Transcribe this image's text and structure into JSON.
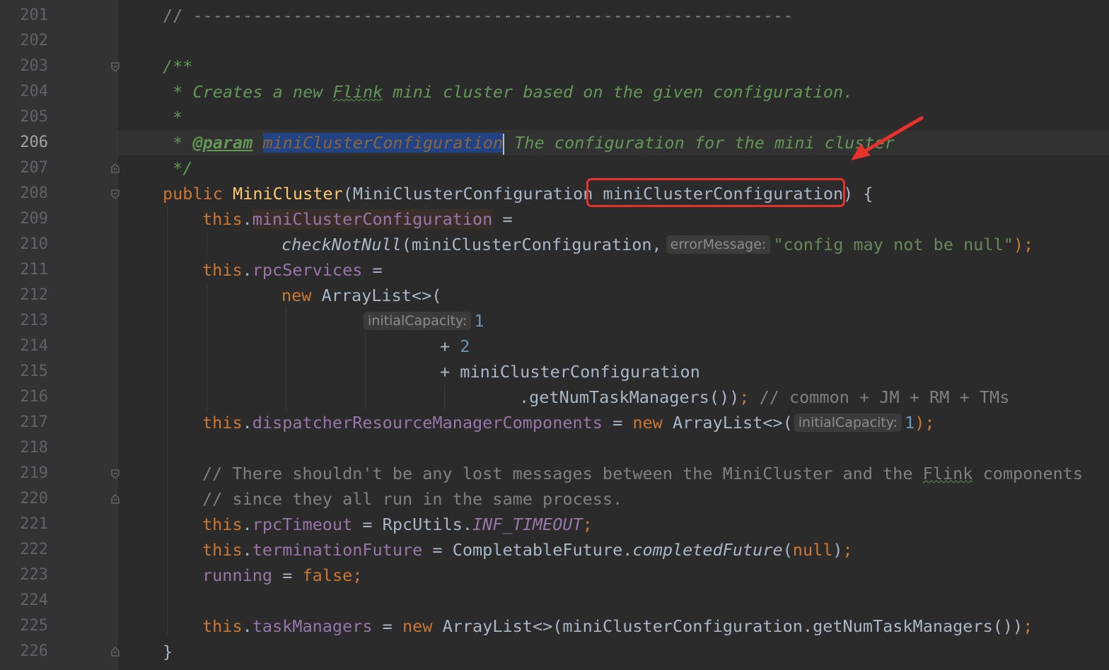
{
  "editor": {
    "current_line": 206,
    "lines": [
      {
        "n": "201",
        "t": "// ------------------------------------------------------------"
      },
      {
        "n": "202",
        "t": ""
      },
      {
        "n": "203",
        "t": "/**"
      },
      {
        "n": "204",
        "t": " * Creates a new Flink mini cluster based on the given configuration."
      },
      {
        "n": "205",
        "t": " *"
      },
      {
        "n": "206",
        "t": " * @param miniClusterConfiguration The configuration for the mini cluster"
      },
      {
        "n": "207",
        "t": " */"
      },
      {
        "n": "208",
        "t": "public MiniCluster(MiniClusterConfiguration miniClusterConfiguration) {"
      },
      {
        "n": "209",
        "t": "this.miniClusterConfiguration ="
      },
      {
        "n": "210",
        "t": "checkNotNull(miniClusterConfiguration, errorMessage: \"config may not be null\");"
      },
      {
        "n": "211",
        "t": "this.rpcServices ="
      },
      {
        "n": "212",
        "t": "new ArrayList<>("
      },
      {
        "n": "213",
        "t": "initialCapacity: 1"
      },
      {
        "n": "214",
        "t": "+ 2"
      },
      {
        "n": "215",
        "t": "+ miniClusterConfiguration"
      },
      {
        "n": "216",
        "t": ".getNumTaskManagers()); // common + JM + RM + TMs"
      },
      {
        "n": "217",
        "t": "this.dispatcherResourceManagerComponents = new ArrayList<>( initialCapacity: 1);"
      },
      {
        "n": "218",
        "t": ""
      },
      {
        "n": "219",
        "t": "// There shouldn't be any lost messages between the MiniCluster and the Flink components"
      },
      {
        "n": "220",
        "t": "// since they all run in the same process."
      },
      {
        "n": "221",
        "t": "this.rpcTimeout = RpcUtils.INF_TIMEOUT;"
      },
      {
        "n": "222",
        "t": "this.terminationFuture = CompletableFuture.completedFuture(null);"
      },
      {
        "n": "223",
        "t": "running = false;"
      },
      {
        "n": "224",
        "t": ""
      },
      {
        "n": "225",
        "t": "this.taskManagers = new ArrayList<>(miniClusterConfiguration.getNumTaskManagers());"
      },
      {
        "n": "226",
        "t": "}"
      }
    ]
  },
  "tokens": {
    "l201": "// ------------------------------------------------------------",
    "l203": "/**",
    "l204_a": " * Creates a new ",
    "l204_b": "Flink",
    "l204_c": " mini cluster based on the given configuration.",
    "l205": " *",
    "l206_a": " * ",
    "l206_tag": "@param",
    "l206_sp": " ",
    "l206_param": "miniClusterConfiguration",
    "l206_rest": " The configuration for the mini cluster",
    "l207": " */",
    "l208_kw": "public",
    "l208_fn": "MiniCluster",
    "l208_a": "(MiniClusterConfiguration",
    "l208_b": " miniClusterConfiguration)",
    "l208_c": " {",
    "this": "this",
    "dot": ".",
    "l209_f": "miniClusterConfiguration",
    "l209_eq": " =",
    "l210_fn": "checkNotNull",
    "l210_a": "(miniClusterConfiguration,",
    "l210_hint": "errorMessage:",
    "l210_str": "\"config may not be null\"",
    "l210_end": ");",
    "l211_f": "rpcServices",
    "l211_eq": " =",
    "new": "new",
    "l212_b": " ArrayList<>(",
    "l213_hint": "initialCapacity:",
    "l213_n": "1",
    "l214_a": "+ ",
    "l214_n": "2",
    "l215": "+ miniClusterConfiguration",
    "l216_a": ".getNumTaskManagers())",
    "l216_semi": ";",
    "l216_cm": " // common + JM + RM + TMs",
    "l217_f": "dispatcherResourceManagerComponents",
    "l217_eq": " = ",
    "l217_b": " ArrayList<>(",
    "l217_hint": "initialCapacity:",
    "l217_n": "1",
    "l217_end": ");",
    "l219_a": "// There shouldn't be any lost messages between the MiniCluster and the ",
    "l219_b": "Flink",
    "l219_c": " components",
    "l220": "// since they all run in the same process.",
    "l221_f": "rpcTimeout",
    "l221_a": " = RpcUtils.",
    "l221_st": "INF_TIMEOUT",
    "semi": ";",
    "l222_f": "terminationFuture",
    "l222_a": " = CompletableFuture.",
    "l222_fn": "completedFuture",
    "l222_b": "(",
    "null": "null",
    "l222_c": ")",
    "l223_f": "running",
    "l223_a": " = ",
    "false": "false",
    "l225_f": "taskManagers",
    "l225_a": " = ",
    "l225_b": " ArrayList<>(miniClusterConfiguration.getNumTaskManagers())",
    "l226": "}"
  },
  "colors": {
    "background": "#2b2b2b",
    "keyword": "#cc7832",
    "comment": "#808080",
    "doc_comment": "#629755",
    "method_decl": "#ffc66d",
    "field": "#9876aa",
    "number": "#6897bb",
    "string": "#6a8759",
    "annotation_box": "#e8312b"
  },
  "annotations": {
    "highlight_box": "red-rounded-rect",
    "arrow": "red-arrow"
  }
}
